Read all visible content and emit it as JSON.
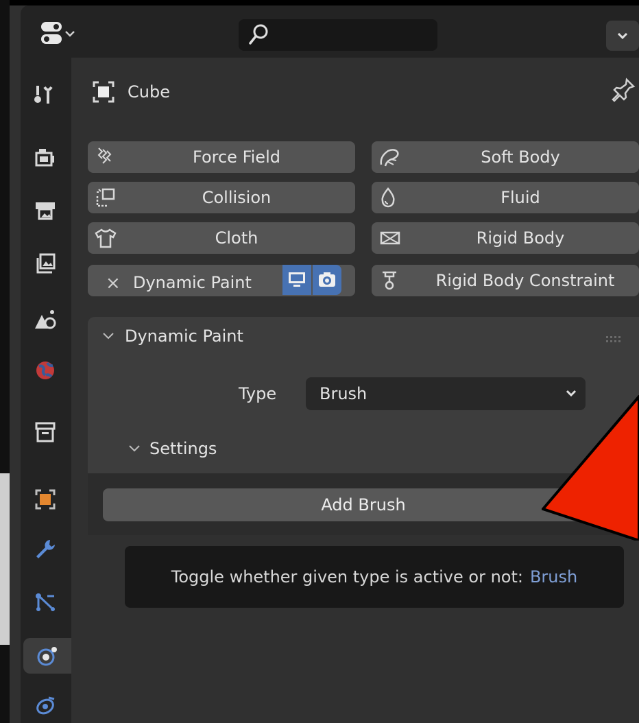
{
  "header": {
    "search_placeholder": ""
  },
  "object": {
    "name": "Cube"
  },
  "physics_buttons": {
    "force_field": "Force Field",
    "soft_body": "Soft Body",
    "collision": "Collision",
    "fluid": "Fluid",
    "cloth": "Cloth",
    "rigid_body": "Rigid Body",
    "dynamic_paint": "Dynamic Paint",
    "rigid_body_constraint": "Rigid Body Constraint",
    "remove_symbol": "×"
  },
  "panel": {
    "title": "Dynamic Paint",
    "type_label": "Type",
    "type_value": "Brush",
    "settings_title": "Settings",
    "add_button": "Add Brush"
  },
  "tooltip": {
    "text": "Toggle whether given type is active or not:",
    "value": "Brush"
  },
  "colors": {
    "accent_blue": "#4772b3",
    "annotation_red": "#ee2200"
  }
}
